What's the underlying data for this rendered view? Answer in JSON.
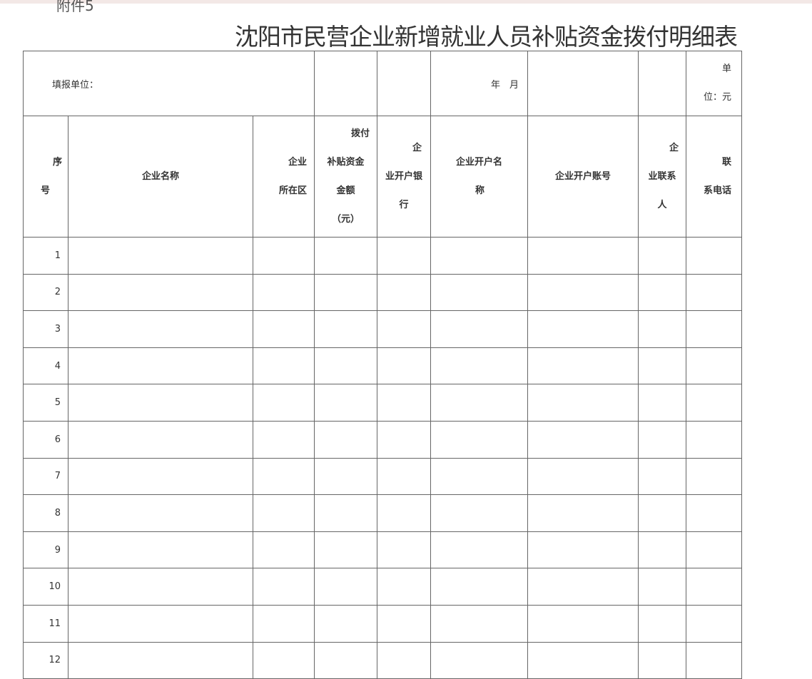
{
  "document": {
    "attachment_label": "附件5",
    "title": "沈阳市民营企业新增就业人员补贴资金拨付明细表",
    "info_row": {
      "filler_label": "填报单位：",
      "date_label": "年　月",
      "unit_line1": "单",
      "unit_line2": "位：元"
    },
    "columns": {
      "seq": [
        "序",
        "号"
      ],
      "company_name": "企业名称",
      "district": [
        "企业",
        "所在区"
      ],
      "amount": [
        "拨付",
        "补贴资金",
        "金额",
        "（元）"
      ],
      "bank": [
        "企",
        "业开户银",
        "行"
      ],
      "account_name": [
        "企业开户名",
        "称"
      ],
      "account_no": "企业开户账号",
      "contact": [
        "企",
        "业联系",
        "人"
      ],
      "phone": [
        "联",
        "系电话"
      ]
    },
    "rows": [
      "1",
      "2",
      "3",
      "4",
      "5",
      "6",
      "7",
      "8",
      "9",
      "10",
      "11",
      "12"
    ]
  },
  "colors": {
    "border": "#666666",
    "text": "#333333",
    "top_strip": "#f3e8e6"
  }
}
